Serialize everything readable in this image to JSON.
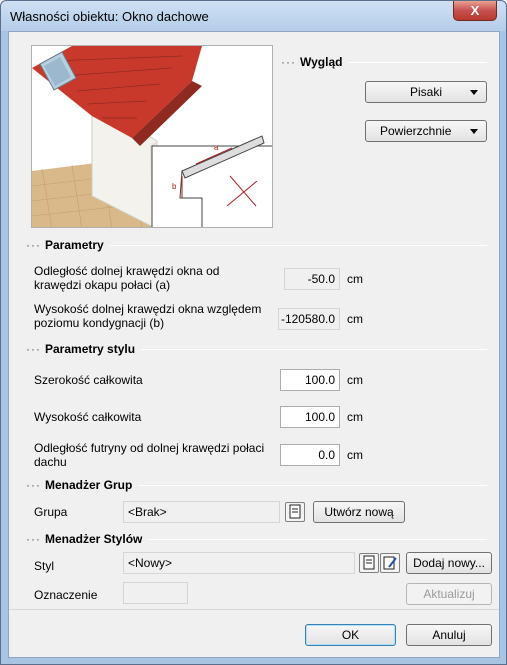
{
  "window": {
    "title": "Własności obiektu: Okno dachowe",
    "close_glyph": "X"
  },
  "appearance": {
    "heading": "Wygląd",
    "pens_button": "Pisaki",
    "surfaces_button": "Powierzchnie",
    "preview_labels": {
      "a": "a",
      "b": "b"
    }
  },
  "parameters": {
    "heading": "Parametry",
    "rows": [
      {
        "label": "Odległość dolnej krawędzi okna od krawędzi okapu połaci (a)",
        "value": "-50.0",
        "unit": "cm"
      },
      {
        "label": "Wysokość dolnej krawędzi okna względem poziomu kondygnacji (b)",
        "value": "-120580.0",
        "unit": "cm"
      }
    ]
  },
  "style_parameters": {
    "heading": "Parametry stylu",
    "rows": [
      {
        "label": "Szerokość całkowita",
        "value": "100.0",
        "unit": "cm"
      },
      {
        "label": "Wysokość całkowita",
        "value": "100.0",
        "unit": "cm"
      },
      {
        "label": "Odległość futryny od dolnej krawędzi połaci dachu",
        "value": "0.0",
        "unit": "cm"
      }
    ]
  },
  "group_manager": {
    "heading": "Menadżer Grup",
    "group_label": "Grupa",
    "group_value": "<Brak>",
    "create_button": "Utwórz nową"
  },
  "style_manager": {
    "heading": "Menadżer Stylów",
    "style_label": "Styl",
    "style_value": "<Nowy>",
    "add_button": "Dodaj nowy...",
    "designation_label": "Oznaczenie",
    "designation_value": "",
    "update_button": "Aktualizuj"
  },
  "footer": {
    "ok_button": "OK",
    "cancel_button": "Anuluj"
  },
  "colors": {
    "roof": "#c8392b",
    "floor": "#d9b98a",
    "wall": "#f4f2ec",
    "title_bar": "#bcd3ee",
    "close": "#c75050"
  }
}
